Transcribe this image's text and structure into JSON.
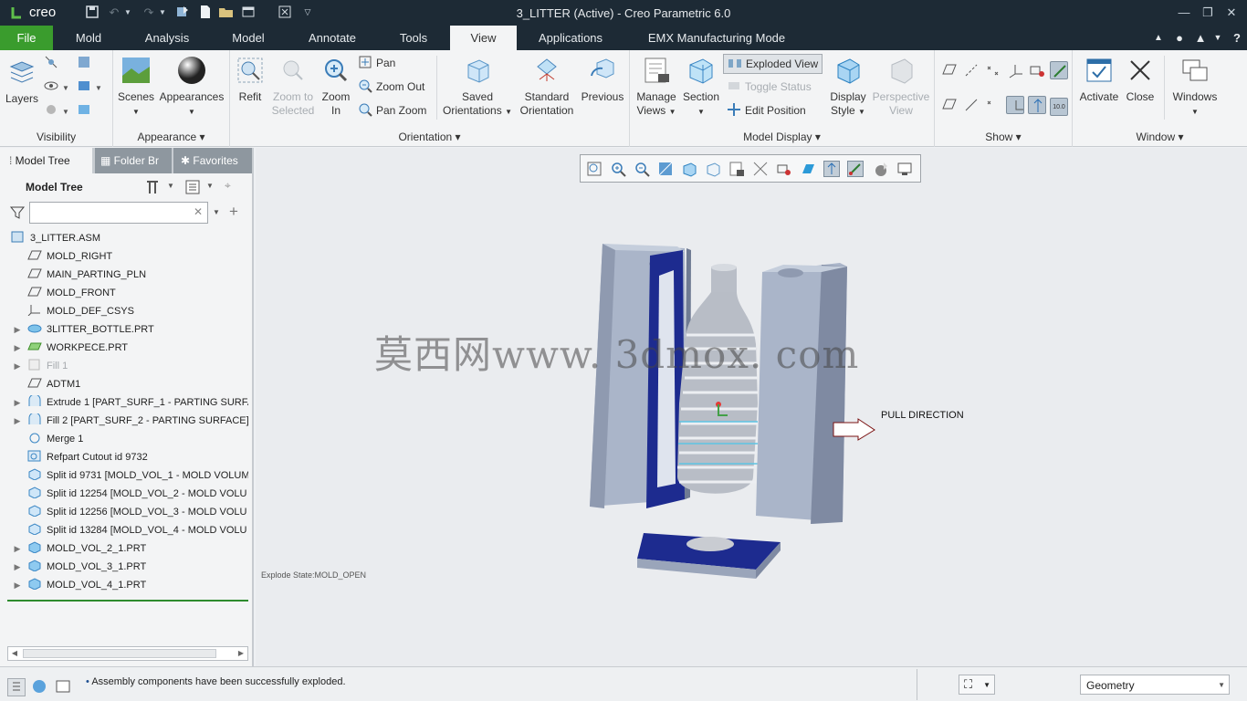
{
  "app": {
    "logo": "creo",
    "window_title": "3_LITTER (Active) - Creo Parametric 6.0"
  },
  "quick_access_icons": [
    "save-icon",
    "undo-icon",
    "undo-dropdown-icon",
    "redo-icon",
    "redo-dropdown-icon",
    "regenerate-icon",
    "new-icon",
    "open-icon",
    "window-icon",
    "close-window-icon",
    "customize-dropdown-icon"
  ],
  "tabs": [
    "File",
    "Mold",
    "Analysis",
    "Model",
    "Annotate",
    "Tools",
    "View",
    "Applications",
    "EMX Manufacturing Mode"
  ],
  "active_tab": "View",
  "ribbon": {
    "visibility": {
      "label": "Visibility",
      "layers": "Layers"
    },
    "appearance": {
      "label": "Appearance",
      "scenes": "Scenes",
      "appearances": "Appearances"
    },
    "orientation": {
      "label": "Orientation",
      "refit": "Refit",
      "zoom_to_selected": "Zoom to Selected",
      "zoom_in": "Zoom In",
      "pan": "Pan",
      "zoom_out": "Zoom Out",
      "pan_zoom": "Pan Zoom",
      "saved_orientations": "Saved Orientations",
      "standard_orientation": "Standard Orientation",
      "previous": "Previous"
    },
    "model_display": {
      "label": "Model Display",
      "manage_views": "Manage Views",
      "section": "Section",
      "exploded_view": "Exploded View",
      "toggle_status": "Toggle Status",
      "edit_position": "Edit Position",
      "display_style": "Display Style",
      "perspective_view": "Perspective View"
    },
    "show": {
      "label": "Show"
    },
    "window": {
      "label": "Window",
      "activate": "Activate",
      "close": "Close",
      "windows": "Windows"
    }
  },
  "panel": {
    "tabs": [
      "Model Tree",
      "Folder Br",
      "Favorites"
    ],
    "header": "Model Tree",
    "search": {
      "value": "",
      "placeholder": ""
    },
    "root": "3_LITTER.ASM",
    "items": [
      {
        "label": "MOLD_RIGHT",
        "icon": "datum-plane-icon",
        "expandable": false,
        "dim": false
      },
      {
        "label": "MAIN_PARTING_PLN",
        "icon": "datum-plane-icon",
        "expandable": false,
        "dim": false
      },
      {
        "label": "MOLD_FRONT",
        "icon": "datum-plane-icon",
        "expandable": false,
        "dim": false
      },
      {
        "label": "MOLD_DEF_CSYS",
        "icon": "csys-icon",
        "expandable": false,
        "dim": false
      },
      {
        "label": "3LITTER_BOTTLE.PRT",
        "icon": "part-icon",
        "expandable": true,
        "dim": false
      },
      {
        "label": "WORKPECE.PRT",
        "icon": "workpiece-icon",
        "expandable": true,
        "dim": false
      },
      {
        "label": "Fill 1",
        "icon": "fill-icon",
        "expandable": true,
        "dim": true
      },
      {
        "label": "ADTM1",
        "icon": "datum-plane-icon",
        "expandable": false,
        "dim": false
      },
      {
        "label": "Extrude 1 [PART_SURF_1 - PARTING SURFAC",
        "icon": "surface-icon",
        "expandable": true,
        "dim": false
      },
      {
        "label": "Fill 2 [PART_SURF_2 - PARTING SURFACE]",
        "icon": "surface-icon",
        "expandable": true,
        "dim": false
      },
      {
        "label": "Merge 1",
        "icon": "merge-icon",
        "expandable": false,
        "dim": false
      },
      {
        "label": "Refpart Cutout id 9732",
        "icon": "refpart-icon",
        "expandable": false,
        "dim": false
      },
      {
        "label": "Split id 9731 [MOLD_VOL_1 - MOLD VOLUM",
        "icon": "split-icon",
        "expandable": false,
        "dim": false
      },
      {
        "label": "Split id 12254 [MOLD_VOL_2 - MOLD VOLU",
        "icon": "split-icon",
        "expandable": false,
        "dim": false
      },
      {
        "label": "Split id 12256 [MOLD_VOL_3 - MOLD VOLU",
        "icon": "split-icon",
        "expandable": false,
        "dim": false
      },
      {
        "label": "Split id 13284 [MOLD_VOL_4 - MOLD VOLU",
        "icon": "split-icon",
        "expandable": false,
        "dim": false
      },
      {
        "label": "MOLD_VOL_2_1.PRT",
        "icon": "mold-part-icon",
        "expandable": true,
        "dim": false
      },
      {
        "label": "MOLD_VOL_3_1.PRT",
        "icon": "mold-part-icon",
        "expandable": true,
        "dim": false
      },
      {
        "label": "MOLD_VOL_4_1.PRT",
        "icon": "mold-part-icon",
        "expandable": true,
        "dim": false
      }
    ]
  },
  "viewport": {
    "pull_direction": "PULL DIRECTION",
    "explode_state": "Explode State:MOLD_OPEN",
    "watermark": "莫西网www. 3dmox. com"
  },
  "status": {
    "message": "Assembly components have been successfully exploded.",
    "filter": "Geometry"
  },
  "colors": {
    "title_bg": "#1d2a35",
    "file_tab": "#3a9c2d",
    "mold_gray": "#a9b4c7",
    "mold_dark_blue": "#1d2b8f"
  }
}
